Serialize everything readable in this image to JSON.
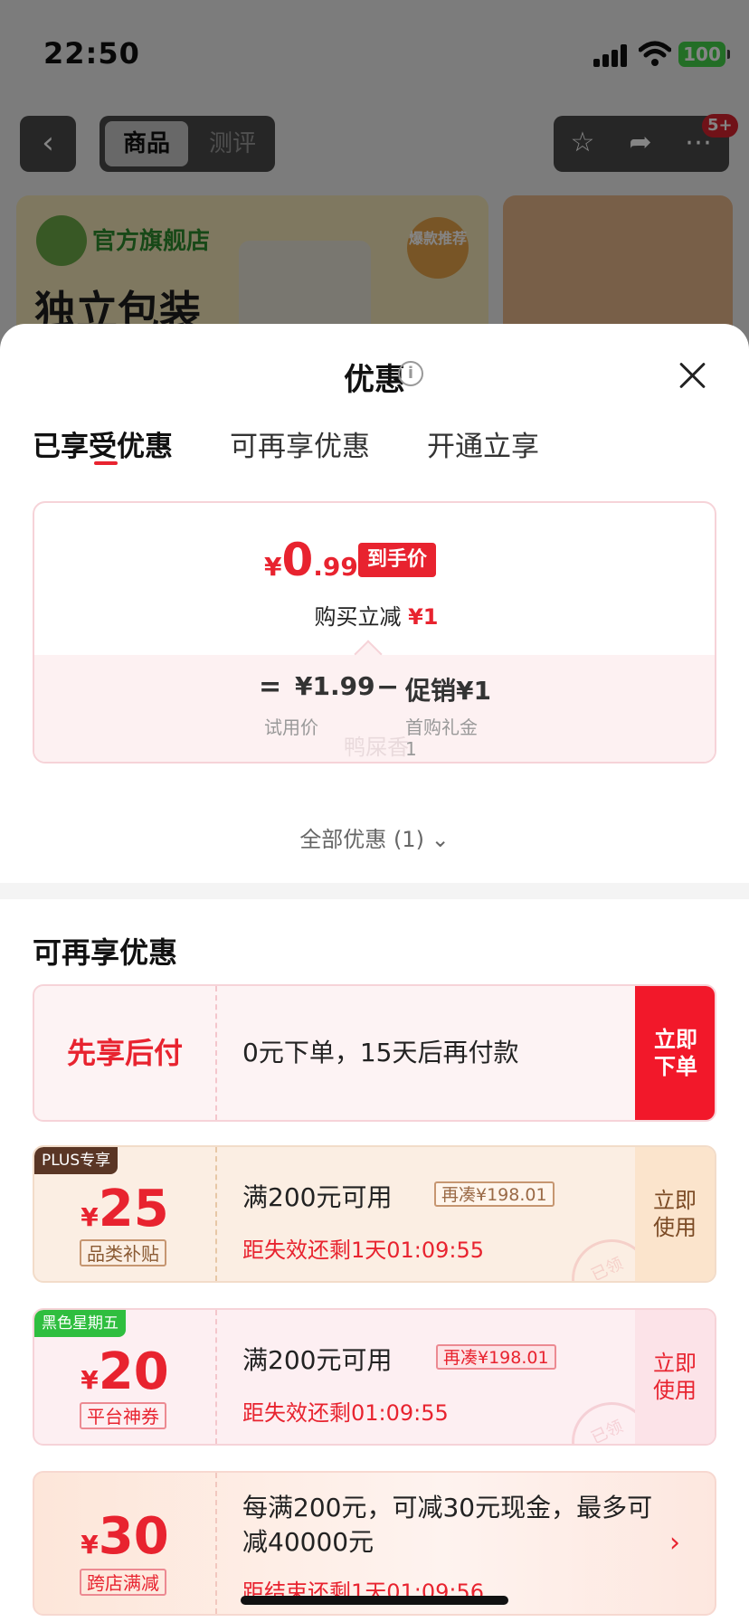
{
  "status_bar": {
    "time": "22:50",
    "battery": "100"
  },
  "nav": {
    "segments": [
      "商品",
      "测评"
    ],
    "badge": "5+"
  },
  "banner": {
    "store_name": "官方旗舰店",
    "title": "独立包装",
    "seal_text": "爆款推荐"
  },
  "sheet": {
    "title": "优惠",
    "tabs": [
      "已享受优惠",
      "可再享优惠",
      "开通立享"
    ],
    "price_card": {
      "currency": "¥",
      "price_int": "0",
      "price_dec": ".99",
      "tag": "到手价",
      "instant_cut_label": "购买立减",
      "instant_cut_value": "¥1",
      "eq": "=",
      "trial_price": "¥1.99",
      "minus": "−",
      "promo": "促销¥1",
      "trial_label": "试用价",
      "promo_label_1": "首购礼金",
      "promo_label_2": "1",
      "watermark": "鸭屎香"
    },
    "all_promotions": "全部优惠 (1)",
    "section_title": "可再享优惠",
    "pay_later": {
      "label": "先享后付",
      "desc": "0元下单，15天后再付款",
      "action_1": "立即",
      "action_2": "下单"
    },
    "coupons": [
      {
        "tag": "PLUS专享",
        "currency": "¥",
        "amount": "25",
        "type": "品类补贴",
        "condition": "满200元可用",
        "more": "再凑¥198.01",
        "expire": "距失效还剩1天01:09:55",
        "stamp": "已领",
        "action_1": "立即",
        "action_2": "使用"
      },
      {
        "tag": "黑色星期五",
        "currency": "¥",
        "amount": "20",
        "type": "平台神券",
        "condition": "满200元可用",
        "more": "再凑¥198.01",
        "expire": "距失效还剩01:09:55",
        "stamp": "已领",
        "action_1": "立即",
        "action_2": "使用"
      },
      {
        "currency": "¥",
        "amount": "30",
        "type": "跨店满减",
        "condition": "每满200元，可减30元现金，最多可减40000元",
        "expire": "距结束还剩1天01:09:56",
        "action": "›"
      }
    ]
  }
}
